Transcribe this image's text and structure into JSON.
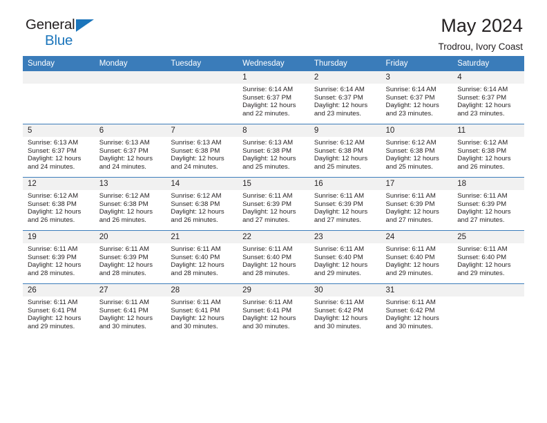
{
  "brand": {
    "name_part1": "General",
    "name_part2": "Blue",
    "triangle_icon": "triangle-icon",
    "colors": {
      "dark": "#231f20",
      "blue": "#1b75bb"
    }
  },
  "header": {
    "title": "May 2024",
    "subtitle": "Trodrou, Ivory Coast"
  },
  "calendar": {
    "header_bg": "#3a7cba",
    "day_band_bg": "#f1f1f1",
    "weekdays": [
      "Sunday",
      "Monday",
      "Tuesday",
      "Wednesday",
      "Thursday",
      "Friday",
      "Saturday"
    ],
    "weeks": [
      [
        {
          "day": "",
          "lines": []
        },
        {
          "day": "",
          "lines": []
        },
        {
          "day": "",
          "lines": []
        },
        {
          "day": "1",
          "lines": [
            "Sunrise: 6:14 AM",
            "Sunset: 6:37 PM",
            "Daylight: 12 hours",
            "and 22 minutes."
          ]
        },
        {
          "day": "2",
          "lines": [
            "Sunrise: 6:14 AM",
            "Sunset: 6:37 PM",
            "Daylight: 12 hours",
            "and 23 minutes."
          ]
        },
        {
          "day": "3",
          "lines": [
            "Sunrise: 6:14 AM",
            "Sunset: 6:37 PM",
            "Daylight: 12 hours",
            "and 23 minutes."
          ]
        },
        {
          "day": "4",
          "lines": [
            "Sunrise: 6:14 AM",
            "Sunset: 6:37 PM",
            "Daylight: 12 hours",
            "and 23 minutes."
          ]
        }
      ],
      [
        {
          "day": "5",
          "lines": [
            "Sunrise: 6:13 AM",
            "Sunset: 6:37 PM",
            "Daylight: 12 hours",
            "and 24 minutes."
          ]
        },
        {
          "day": "6",
          "lines": [
            "Sunrise: 6:13 AM",
            "Sunset: 6:37 PM",
            "Daylight: 12 hours",
            "and 24 minutes."
          ]
        },
        {
          "day": "7",
          "lines": [
            "Sunrise: 6:13 AM",
            "Sunset: 6:38 PM",
            "Daylight: 12 hours",
            "and 24 minutes."
          ]
        },
        {
          "day": "8",
          "lines": [
            "Sunrise: 6:13 AM",
            "Sunset: 6:38 PM",
            "Daylight: 12 hours",
            "and 25 minutes."
          ]
        },
        {
          "day": "9",
          "lines": [
            "Sunrise: 6:12 AM",
            "Sunset: 6:38 PM",
            "Daylight: 12 hours",
            "and 25 minutes."
          ]
        },
        {
          "day": "10",
          "lines": [
            "Sunrise: 6:12 AM",
            "Sunset: 6:38 PM",
            "Daylight: 12 hours",
            "and 25 minutes."
          ]
        },
        {
          "day": "11",
          "lines": [
            "Sunrise: 6:12 AM",
            "Sunset: 6:38 PM",
            "Daylight: 12 hours",
            "and 26 minutes."
          ]
        }
      ],
      [
        {
          "day": "12",
          "lines": [
            "Sunrise: 6:12 AM",
            "Sunset: 6:38 PM",
            "Daylight: 12 hours",
            "and 26 minutes."
          ]
        },
        {
          "day": "13",
          "lines": [
            "Sunrise: 6:12 AM",
            "Sunset: 6:38 PM",
            "Daylight: 12 hours",
            "and 26 minutes."
          ]
        },
        {
          "day": "14",
          "lines": [
            "Sunrise: 6:12 AM",
            "Sunset: 6:38 PM",
            "Daylight: 12 hours",
            "and 26 minutes."
          ]
        },
        {
          "day": "15",
          "lines": [
            "Sunrise: 6:11 AM",
            "Sunset: 6:39 PM",
            "Daylight: 12 hours",
            "and 27 minutes."
          ]
        },
        {
          "day": "16",
          "lines": [
            "Sunrise: 6:11 AM",
            "Sunset: 6:39 PM",
            "Daylight: 12 hours",
            "and 27 minutes."
          ]
        },
        {
          "day": "17",
          "lines": [
            "Sunrise: 6:11 AM",
            "Sunset: 6:39 PM",
            "Daylight: 12 hours",
            "and 27 minutes."
          ]
        },
        {
          "day": "18",
          "lines": [
            "Sunrise: 6:11 AM",
            "Sunset: 6:39 PM",
            "Daylight: 12 hours",
            "and 27 minutes."
          ]
        }
      ],
      [
        {
          "day": "19",
          "lines": [
            "Sunrise: 6:11 AM",
            "Sunset: 6:39 PM",
            "Daylight: 12 hours",
            "and 28 minutes."
          ]
        },
        {
          "day": "20",
          "lines": [
            "Sunrise: 6:11 AM",
            "Sunset: 6:39 PM",
            "Daylight: 12 hours",
            "and 28 minutes."
          ]
        },
        {
          "day": "21",
          "lines": [
            "Sunrise: 6:11 AM",
            "Sunset: 6:40 PM",
            "Daylight: 12 hours",
            "and 28 minutes."
          ]
        },
        {
          "day": "22",
          "lines": [
            "Sunrise: 6:11 AM",
            "Sunset: 6:40 PM",
            "Daylight: 12 hours",
            "and 28 minutes."
          ]
        },
        {
          "day": "23",
          "lines": [
            "Sunrise: 6:11 AM",
            "Sunset: 6:40 PM",
            "Daylight: 12 hours",
            "and 29 minutes."
          ]
        },
        {
          "day": "24",
          "lines": [
            "Sunrise: 6:11 AM",
            "Sunset: 6:40 PM",
            "Daylight: 12 hours",
            "and 29 minutes."
          ]
        },
        {
          "day": "25",
          "lines": [
            "Sunrise: 6:11 AM",
            "Sunset: 6:40 PM",
            "Daylight: 12 hours",
            "and 29 minutes."
          ]
        }
      ],
      [
        {
          "day": "26",
          "lines": [
            "Sunrise: 6:11 AM",
            "Sunset: 6:41 PM",
            "Daylight: 12 hours",
            "and 29 minutes."
          ]
        },
        {
          "day": "27",
          "lines": [
            "Sunrise: 6:11 AM",
            "Sunset: 6:41 PM",
            "Daylight: 12 hours",
            "and 30 minutes."
          ]
        },
        {
          "day": "28",
          "lines": [
            "Sunrise: 6:11 AM",
            "Sunset: 6:41 PM",
            "Daylight: 12 hours",
            "and 30 minutes."
          ]
        },
        {
          "day": "29",
          "lines": [
            "Sunrise: 6:11 AM",
            "Sunset: 6:41 PM",
            "Daylight: 12 hours",
            "and 30 minutes."
          ]
        },
        {
          "day": "30",
          "lines": [
            "Sunrise: 6:11 AM",
            "Sunset: 6:42 PM",
            "Daylight: 12 hours",
            "and 30 minutes."
          ]
        },
        {
          "day": "31",
          "lines": [
            "Sunrise: 6:11 AM",
            "Sunset: 6:42 PM",
            "Daylight: 12 hours",
            "and 30 minutes."
          ]
        },
        {
          "day": "",
          "lines": []
        }
      ]
    ]
  }
}
